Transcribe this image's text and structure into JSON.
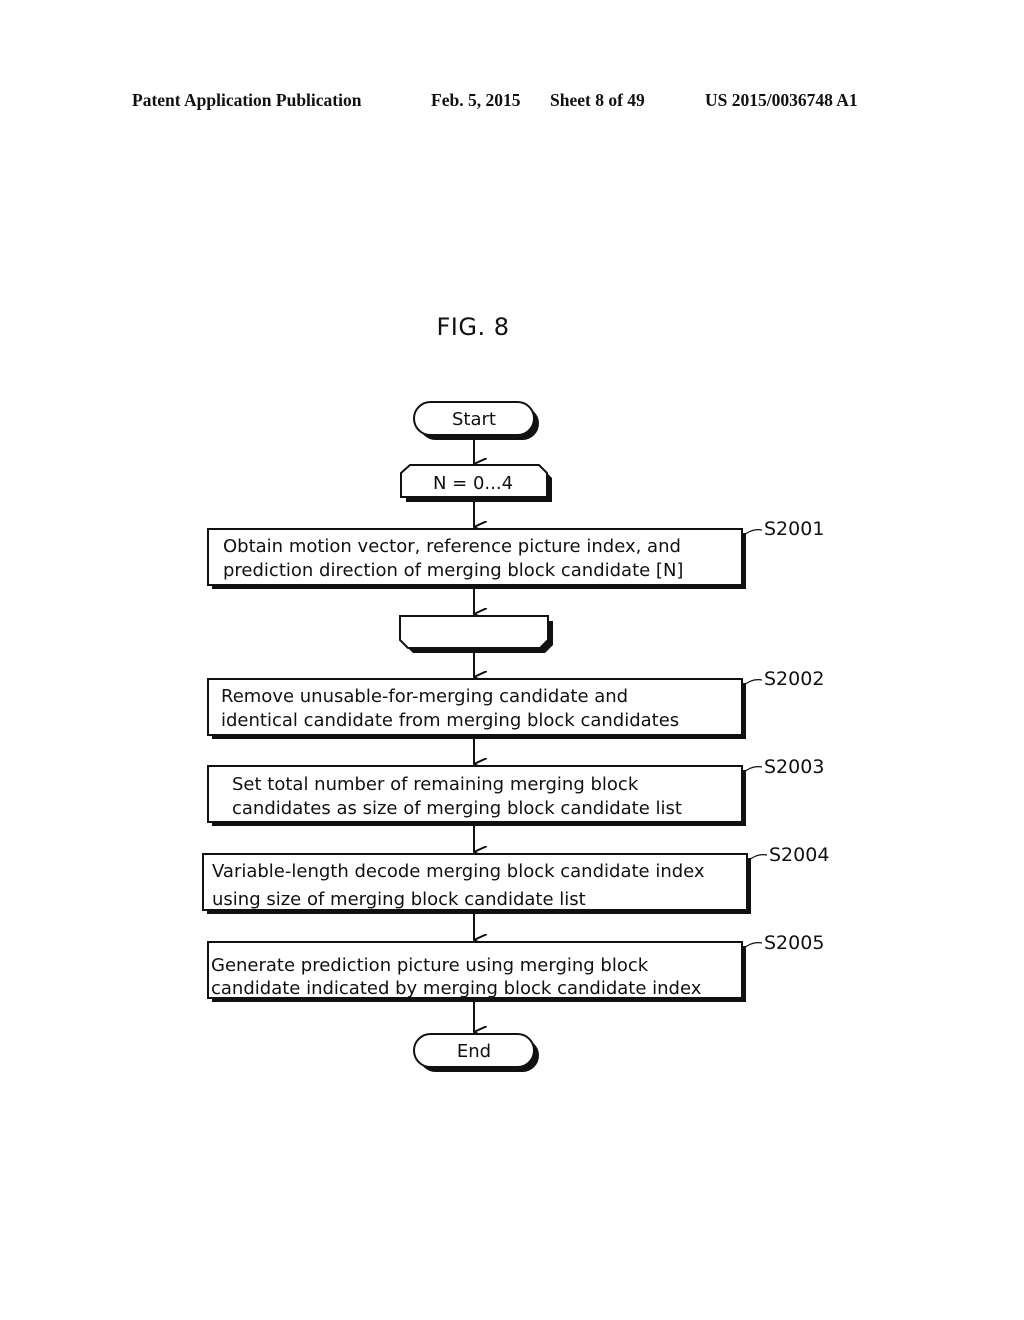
{
  "header": {
    "publication_type": "Patent Application Publication",
    "date": "Feb. 5, 2015",
    "sheet": "Sheet 8 of 49",
    "publication_number": "US 2015/0036748 A1"
  },
  "figure": {
    "title": "FIG. 8",
    "start_label": "Start",
    "end_label": "End",
    "loop_start_label": "N = 0...4",
    "loop_end_label": "",
    "steps": [
      {
        "id": "S2001",
        "lines": [
          "Obtain motion vector, reference picture index, and",
          "prediction direction of merging block candidate [N]"
        ]
      },
      {
        "id": "S2002",
        "lines": [
          "Remove unusable-for-merging candidate and",
          "identical candidate from merging block candidates"
        ]
      },
      {
        "id": "S2003",
        "lines": [
          "Set total number of remaining merging block",
          "candidates as size of merging block candidate list"
        ]
      },
      {
        "id": "S2004",
        "lines": [
          "Variable-length decode merging block candidate index",
          "using size of merging block candidate list"
        ]
      },
      {
        "id": "S2005",
        "lines": [
          "Generate prediction picture using merging block",
          "candidate indicated by merging block candidate index"
        ]
      }
    ]
  }
}
